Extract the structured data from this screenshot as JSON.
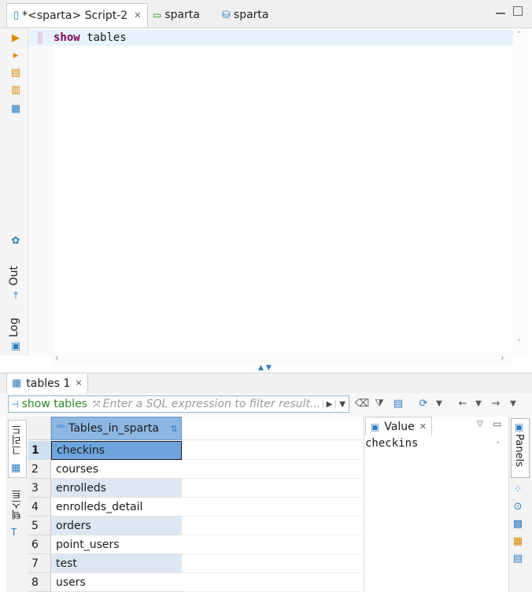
{
  "editor_tabs": [
    {
      "label": "*<sparta> Script-2",
      "active": true
    },
    {
      "label": "sparta",
      "active": false
    },
    {
      "label": "sparta",
      "active": false
    }
  ],
  "editor": {
    "keyword": "show",
    "rest": "tables"
  },
  "left_toolbar": {
    "output_label": "Out",
    "log_label": "Log"
  },
  "results": {
    "tab_label": "tables 1",
    "filter_query": "show tables",
    "filter_placeholder": "Enter a SQL expression to filter result..."
  },
  "grid": {
    "side_labels": {
      "grid": "그리드",
      "text": "텍스트"
    },
    "column": "Tables_in_sparta",
    "rows": [
      {
        "num": "1",
        "value": "checkins"
      },
      {
        "num": "2",
        "value": "courses"
      },
      {
        "num": "3",
        "value": "enrolleds"
      },
      {
        "num": "4",
        "value": "enrolleds_detail"
      },
      {
        "num": "5",
        "value": "orders"
      },
      {
        "num": "6",
        "value": "point_users"
      },
      {
        "num": "7",
        "value": "test"
      },
      {
        "num": "8",
        "value": "users"
      }
    ]
  },
  "value_panel": {
    "tab_label": "Value",
    "content": "checkins"
  },
  "right_bar": {
    "panels_label": "Panels"
  },
  "colors": {
    "selected_header": "#8db6e2",
    "alt_row": "#dde7f3",
    "selected_cell": "#6ea5de",
    "keyword": "#7f0055",
    "filter_query": "#2a8a2a"
  }
}
